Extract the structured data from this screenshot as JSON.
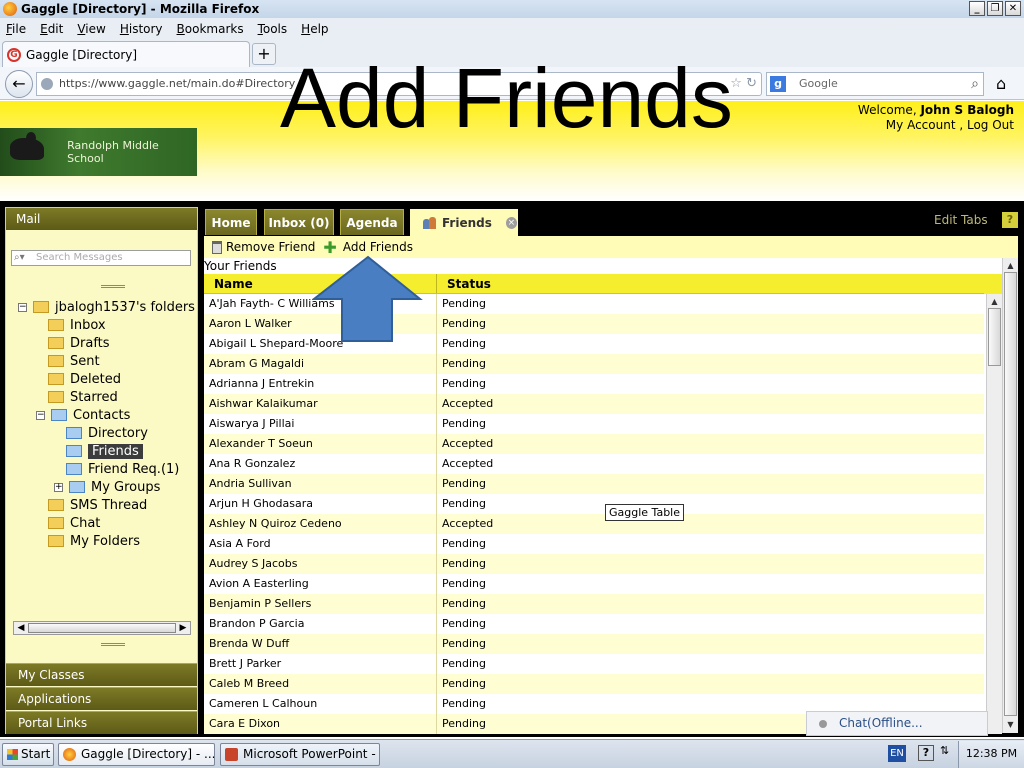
{
  "window": {
    "title": "Gaggle [Directory] - Mozilla Firefox",
    "btn_min": "_",
    "btn_max": "❐",
    "btn_close": "✕"
  },
  "menu": [
    "File",
    "Edit",
    "View",
    "History",
    "Bookmarks",
    "Tools",
    "Help"
  ],
  "browser": {
    "tab_label": "Gaggle [Directory]",
    "new_tab": "+",
    "url_domain": "https://www.gaggle.net",
    "url_path": "/main.do#Directory",
    "search_placeholder": "Google",
    "icons": [
      "back-arrow-icon",
      "globe-icon",
      "star-icon",
      "reload-icon",
      "google-icon",
      "magnifier-icon",
      "home-icon"
    ]
  },
  "overlay_title": "Add Friends",
  "header": {
    "welcome_prefix": "Welcome,",
    "user_name": "John S Balogh",
    "my_account": "My Account",
    "separator": " , ",
    "logout": "Log Out",
    "school_name": "Randolph Middle School"
  },
  "left_panel": {
    "mail_title": "Mail",
    "search_placeholder": "Search Messages",
    "tree": [
      {
        "label": "jbalogh1537's folders",
        "expander": "−",
        "folder": "yellow"
      },
      {
        "label": "Inbox",
        "folder": "yellow"
      },
      {
        "label": "Drafts",
        "folder": "yellow"
      },
      {
        "label": "Sent",
        "folder": "yellow"
      },
      {
        "label": "Deleted",
        "folder": "yellow"
      },
      {
        "label": "Starred",
        "folder": "yellow"
      },
      {
        "label": "Contacts",
        "expander": "−",
        "folder": "blue"
      },
      {
        "label": "Directory",
        "folder": "blue"
      },
      {
        "label": "Friends",
        "folder": "blue",
        "selected": true
      },
      {
        "label": "Friend Req.(1)",
        "folder": "blue"
      },
      {
        "label": "My Groups",
        "expander": "+",
        "folder": "blue"
      },
      {
        "label": "SMS Thread",
        "folder": "yellow"
      },
      {
        "label": "Chat",
        "folder": "yellow"
      },
      {
        "label": "My Folders",
        "folder": "yellow"
      }
    ],
    "nav": [
      "My Classes",
      "Applications",
      "Portal Links"
    ]
  },
  "app_tabs": {
    "home": "Home",
    "inbox": "Inbox (0)",
    "agenda": "Agenda",
    "friends": "Friends",
    "close": "×",
    "edit_tabs": "Edit Tabs",
    "help": "?"
  },
  "toolbar": {
    "remove": "Remove Friend",
    "add": "Add Friends"
  },
  "table": {
    "caption": "Your Friends",
    "columns": [
      "Name",
      "Status"
    ],
    "rows": [
      [
        "A'Jah Fayth- C Williams",
        "Pending"
      ],
      [
        "Aaron L Walker",
        "Pending"
      ],
      [
        "Abigail L Shepard-Moore",
        "Pending"
      ],
      [
        "Abram G Magaldi",
        "Pending"
      ],
      [
        "Adrianna J Entrekin",
        "Pending"
      ],
      [
        "Aishwar Kalaikumar",
        "Accepted"
      ],
      [
        "Aiswarya J Pillai",
        "Pending"
      ],
      [
        "Alexander T Soeun",
        "Accepted"
      ],
      [
        "Ana R Gonzalez",
        "Accepted"
      ],
      [
        "Andria Sullivan",
        "Pending"
      ],
      [
        "Arjun H Ghodasara",
        "Pending"
      ],
      [
        "Ashley N Quiroz Cedeno",
        "Accepted"
      ],
      [
        "Asia A Ford",
        "Pending"
      ],
      [
        "Audrey S Jacobs",
        "Pending"
      ],
      [
        "Avion A Easterling",
        "Pending"
      ],
      [
        "Benjamin P Sellers",
        "Pending"
      ],
      [
        "Brandon P Garcia",
        "Pending"
      ],
      [
        "Brenda W Duff",
        "Pending"
      ],
      [
        "Brett J Parker",
        "Pending"
      ],
      [
        "Caleb M Breed",
        "Pending"
      ],
      [
        "Cameren L Calhoun",
        "Pending"
      ],
      [
        "Cara E Dixon",
        "Pending"
      ]
    ]
  },
  "tooltip": "Gaggle Table",
  "chat": "Chat(Offline...",
  "taskbar": {
    "start": "Start",
    "items": [
      "Gaggle [Directory] - ...",
      "Microsoft PowerPoint - [..."
    ],
    "lang": "EN",
    "help": "?",
    "clock": "12:38 PM"
  },
  "colors": {
    "accent_yellow": "#f5ee2e",
    "tab_olive": "#6b6820",
    "arrow_blue": "#4a7ec2"
  }
}
